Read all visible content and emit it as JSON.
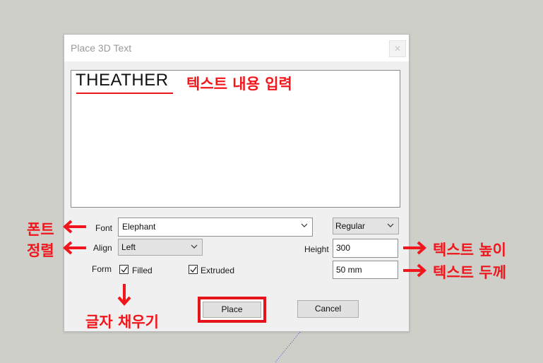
{
  "dialog": {
    "title": "Place 3D Text",
    "close_glyph": "✕",
    "text_value": "THEATHER",
    "font_label": "Font",
    "font_value": "Elephant",
    "style_value": "Regular",
    "align_label": "Align",
    "align_value": "Left",
    "height_label": "Height",
    "height_value": "300",
    "thickness_value": "50 mm",
    "form_label": "Form",
    "filled_label": "Filled",
    "filled_checked": true,
    "extruded_label": "Extruded",
    "extruded_checked": true,
    "place_label": "Place",
    "cancel_label": "Cancel"
  },
  "annotations": {
    "text_content": "텍스트 내용 입력",
    "font": "폰트",
    "align": "정렬",
    "text_height": "텍스트 높이",
    "text_thickness": "텍스트 두께",
    "fill": "글자 채우기"
  },
  "colors": {
    "annotation_red": "#f0161c",
    "background": "#cfcfca",
    "dialog_bg": "#f0f0f0"
  },
  "icons": [
    "close-icon",
    "chevron-down-icon",
    "check-icon",
    "arrow-left-icon",
    "arrow-right-icon",
    "arrow-down-icon"
  ]
}
